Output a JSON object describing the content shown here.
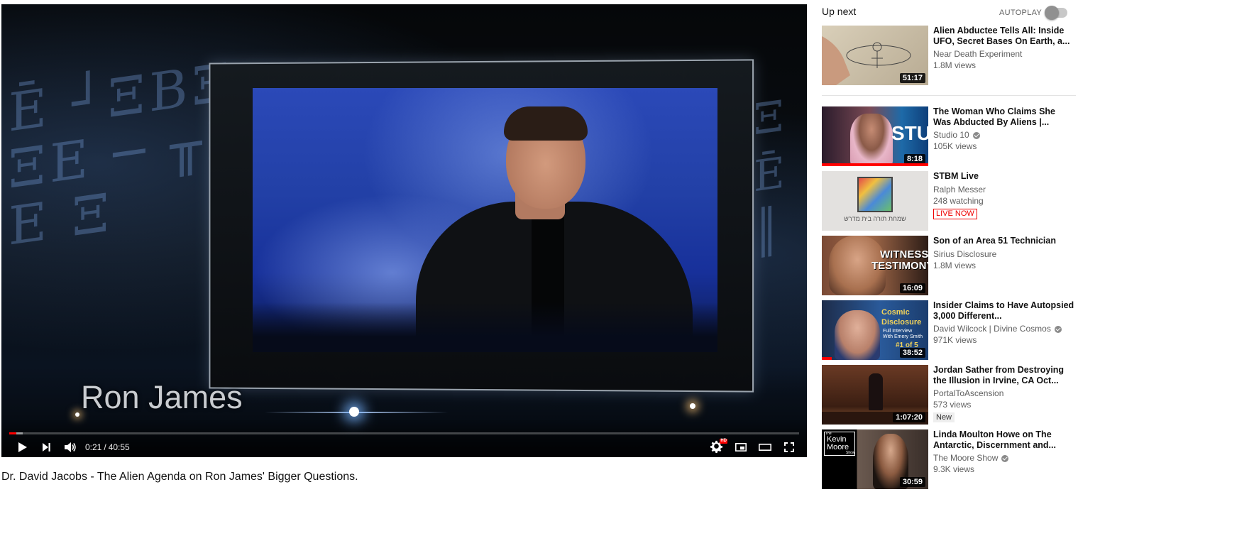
{
  "player": {
    "overlay_name": "Ron James",
    "current_time": "0:21",
    "separator": "/",
    "duration": "40:55",
    "progress_fraction": 0.0086,
    "loaded_fraction": 0.017,
    "hd_badge": "HD"
  },
  "video": {
    "title": "Dr. David Jacobs - The Alien Agenda on Ron James' Bigger Questions."
  },
  "sidebar": {
    "up_next_label": "Up next",
    "autoplay_label": "AUTOPLAY",
    "autoplay_on": false
  },
  "recommendations": [
    {
      "title": "Alien Abductee Tells All: Inside UFO, Secret Bases On Earth, a...",
      "channel": "Near Death Experiment",
      "verified": false,
      "stats": "1.8M views",
      "duration": "51:17"
    },
    {
      "title": "The Woman Who Claims She Was Abducted By Aliens |...",
      "channel": "Studio 10",
      "verified": true,
      "stats": "105K views",
      "duration": "8:18",
      "watched_fraction": 1.0,
      "thumb_text": "STU"
    },
    {
      "title": "STBM Live",
      "channel": "Ralph Messer",
      "verified": false,
      "stats": "248 watching",
      "badge": "LIVE NOW",
      "thumb_text": "שמחת תורה בית מדרש"
    },
    {
      "title": "Son of an Area 51 Technician",
      "channel": "Sirius Disclosure",
      "verified": false,
      "stats": "1.8M views",
      "duration": "16:09",
      "thumb_text_1": "WITNESS",
      "thumb_text_2": "TESTIMONY"
    },
    {
      "title": "Insider Claims to Have Autopsied 3,000 Different...",
      "channel": "David Wilcock | Divine Cosmos",
      "verified": true,
      "stats": "971K views",
      "duration": "38:52",
      "watched_fraction": 0.09,
      "thumb_text_1": "Cosmic",
      "thumb_text_2": "Disclosure",
      "thumb_text_3": "Full Interview",
      "thumb_text_4": "With Emery Smith",
      "thumb_text_5": "#1 of 5"
    },
    {
      "title": "Jordan Sather from Destroying the Illusion in Irvine, CA Oct...",
      "channel": "PortalToAscension",
      "verified": false,
      "stats": "573 views",
      "badge": "New",
      "duration": "1:07:20"
    },
    {
      "title": "Linda Moulton Howe on The Antarctic, Discernment and...",
      "channel": "The Moore Show",
      "verified": true,
      "stats": "9.3K views",
      "duration": "30:59",
      "thumb_text_1": "The",
      "thumb_text_2": "Kevin",
      "thumb_text_3": "Moore",
      "thumb_text_4": "Show"
    }
  ],
  "colors": {
    "accent_red": "#ff0000",
    "meta_gray": "#606060",
    "title_black": "#111111"
  },
  "icons": {
    "play": "play-icon",
    "next": "next-icon",
    "volume": "volume-icon",
    "settings": "gear-icon",
    "miniplayer": "miniplayer-icon",
    "theater": "theater-mode-icon",
    "fullscreen": "fullscreen-icon",
    "verified": "verified-check-icon"
  }
}
